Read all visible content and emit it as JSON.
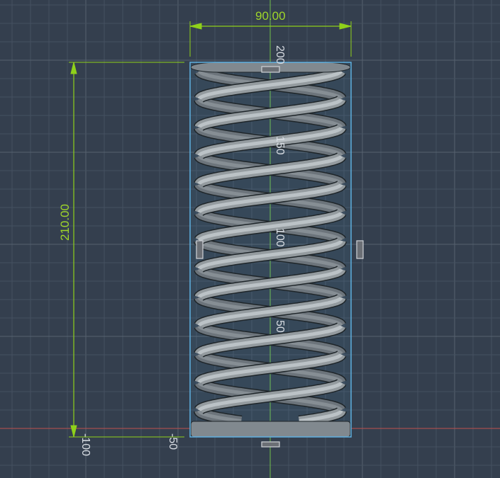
{
  "viewport": {
    "background": "#343f4e",
    "grid_color": "#4a5666",
    "x_axis_color": "#c0504d",
    "y_axis_color": "#6fbf4a"
  },
  "dimensions": {
    "width_label": "90.00",
    "height_label": "210.00",
    "color": "#8fd11a"
  },
  "axis_labels": {
    "y": [
      "200",
      "150",
      "100",
      "50"
    ],
    "x": [
      "-100",
      "-50"
    ]
  },
  "selection_color": "#5fb0e0"
}
